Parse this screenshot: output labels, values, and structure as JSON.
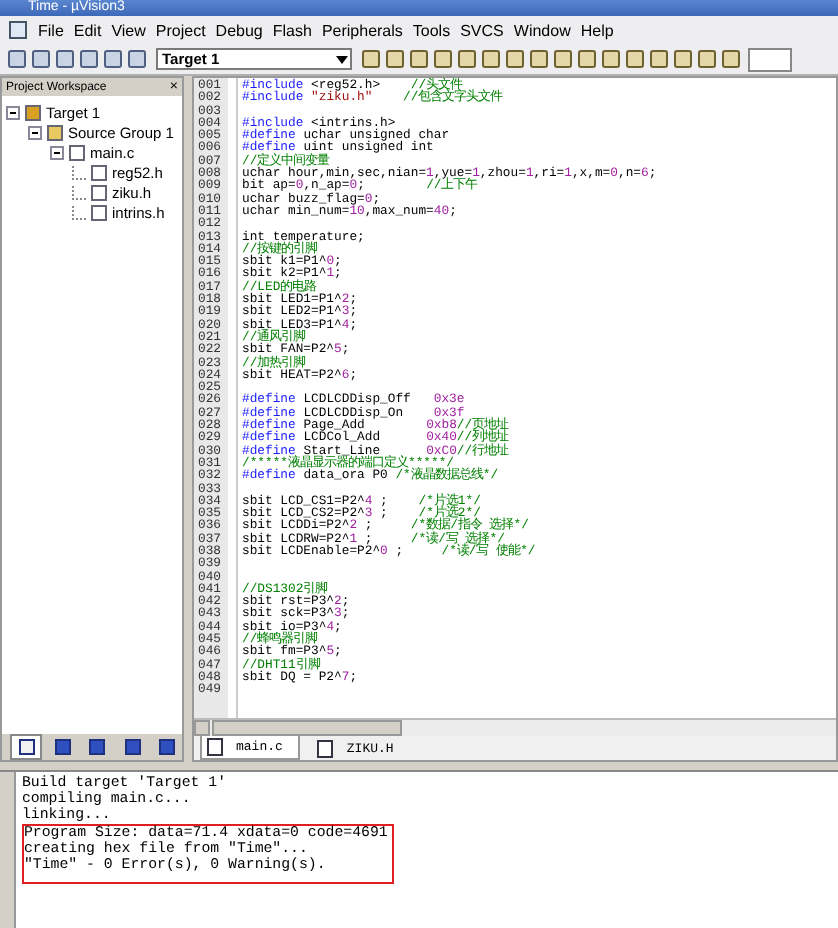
{
  "window": {
    "title": "Time - µVision3"
  },
  "menu": [
    "File",
    "Edit",
    "View",
    "Project",
    "Debug",
    "Flash",
    "Peripherals",
    "Tools",
    "SVCS",
    "Window",
    "Help"
  ],
  "toolbar": {
    "target": "Target 1"
  },
  "workspace": {
    "title": "Project Workspace",
    "close": "×",
    "tree": [
      {
        "label": "Target 1",
        "kind": "target",
        "expanded": true,
        "children": [
          {
            "label": "Source Group 1",
            "kind": "group",
            "expanded": true,
            "children": [
              {
                "label": "main.c",
                "kind": "source",
                "expanded": true,
                "children": [
                  {
                    "label": "reg52.h",
                    "kind": "header"
                  },
                  {
                    "label": "ziku.h",
                    "kind": "header"
                  },
                  {
                    "label": "intrins.h",
                    "kind": "header"
                  }
                ]
              }
            ]
          }
        ]
      }
    ],
    "tabs": [
      {
        "selected": true
      },
      {
        "selected": false
      },
      {
        "selected": false
      },
      {
        "selected": false
      },
      {
        "selected": false
      }
    ]
  },
  "editor": {
    "lines": [
      {
        "num": "001",
        "s": [
          {
            "text": "#include",
            "kind": "kw"
          },
          {
            "text": " <reg52.h>    ",
            "kind": "plain"
          },
          {
            "text": "//头文件",
            "kind": "comment"
          }
        ]
      },
      {
        "num": "002",
        "s": [
          {
            "text": "#include",
            "kind": "kw"
          },
          {
            "text": " \"ziku.h\"    ",
            "kind": "str"
          },
          {
            "text": "//包含文字头文件",
            "kind": "comment"
          }
        ]
      },
      {
        "num": "003"
      },
      {
        "num": "004",
        "s": [
          {
            "text": "#include",
            "kind": "kw"
          },
          {
            "text": " <intrins.h>",
            "kind": "plain"
          }
        ]
      },
      {
        "num": "005",
        "s": [
          {
            "text": "#define",
            "kind": "kw"
          },
          {
            "text": " uchar unsigned char",
            "kind": "plain"
          }
        ]
      },
      {
        "num": "006",
        "s": [
          {
            "text": "#define",
            "kind": "kw"
          },
          {
            "text": " uint unsigned int",
            "kind": "plain"
          }
        ]
      },
      {
        "num": "007",
        "s": [
          {
            "text": "//定义中间变量",
            "kind": "comment"
          }
        ]
      },
      {
        "num": "008",
        "s": [
          {
            "text": "uchar hour,min,sec,nian=",
            "kind": "plain"
          },
          {
            "text": "1",
            "kind": "num"
          },
          {
            "text": ",yue=",
            "kind": "plain"
          },
          {
            "text": "1",
            "kind": "num"
          },
          {
            "text": ",zhou=",
            "kind": "plain"
          },
          {
            "text": "1",
            "kind": "num"
          },
          {
            "text": ",ri=",
            "kind": "plain"
          },
          {
            "text": "1",
            "kind": "num"
          },
          {
            "text": ",x,m=",
            "kind": "plain"
          },
          {
            "text": "0",
            "kind": "num"
          },
          {
            "text": ",n=",
            "kind": "plain"
          },
          {
            "text": "6",
            "kind": "num"
          },
          {
            "text": ";",
            "kind": "plain"
          }
        ]
      },
      {
        "num": "009",
        "s": [
          {
            "text": "bit ap=",
            "kind": "plain"
          },
          {
            "text": "0",
            "kind": "num"
          },
          {
            "text": ",n_ap=",
            "kind": "plain"
          },
          {
            "text": "0",
            "kind": "num"
          },
          {
            "text": ";        ",
            "kind": "plain"
          },
          {
            "text": "//上下午",
            "kind": "comment"
          }
        ]
      },
      {
        "num": "010",
        "s": [
          {
            "text": "uchar buzz_flag=",
            "kind": "plain"
          },
          {
            "text": "0",
            "kind": "num"
          },
          {
            "text": ";",
            "kind": "plain"
          }
        ]
      },
      {
        "num": "011",
        "s": [
          {
            "text": "uchar min_num=",
            "kind": "plain"
          },
          {
            "text": "10",
            "kind": "num"
          },
          {
            "text": ",max_num=",
            "kind": "plain"
          },
          {
            "text": "40",
            "kind": "num"
          },
          {
            "text": ";",
            "kind": "plain"
          }
        ]
      },
      {
        "num": "012"
      },
      {
        "num": "013",
        "s": [
          {
            "text": "int temperature;",
            "kind": "plain"
          }
        ]
      },
      {
        "num": "014",
        "s": [
          {
            "text": "//按键的引脚",
            "kind": "comment"
          }
        ]
      },
      {
        "num": "015",
        "s": [
          {
            "text": "sbit k1=P1^",
            "kind": "plain"
          },
          {
            "text": "0",
            "kind": "num"
          },
          {
            "text": ";",
            "kind": "plain"
          }
        ]
      },
      {
        "num": "016",
        "s": [
          {
            "text": "sbit k2=P1^",
            "kind": "plain"
          },
          {
            "text": "1",
            "kind": "num"
          },
          {
            "text": ";",
            "kind": "plain"
          }
        ]
      },
      {
        "num": "017",
        "s": [
          {
            "text": "//LED的电路",
            "kind": "comment"
          }
        ]
      },
      {
        "num": "018",
        "s": [
          {
            "text": "sbit LED1=P1^",
            "kind": "plain"
          },
          {
            "text": "2",
            "kind": "num"
          },
          {
            "text": ";",
            "kind": "plain"
          }
        ]
      },
      {
        "num": "019",
        "s": [
          {
            "text": "sbit LED2=P1^",
            "kind": "plain"
          },
          {
            "text": "3",
            "kind": "num"
          },
          {
            "text": ";",
            "kind": "plain"
          }
        ]
      },
      {
        "num": "020",
        "s": [
          {
            "text": "sbit LED3=P1^",
            "kind": "plain"
          },
          {
            "text": "4",
            "kind": "num"
          },
          {
            "text": ";",
            "kind": "plain"
          }
        ]
      },
      {
        "num": "021",
        "s": [
          {
            "text": "//通风引脚",
            "kind": "comment"
          }
        ]
      },
      {
        "num": "022",
        "s": [
          {
            "text": "sbit FAN=P2^",
            "kind": "plain"
          },
          {
            "text": "5",
            "kind": "num"
          },
          {
            "text": ";",
            "kind": "plain"
          }
        ]
      },
      {
        "num": "023",
        "s": [
          {
            "text": "//加热引脚",
            "kind": "comment"
          }
        ]
      },
      {
        "num": "024",
        "s": [
          {
            "text": "sbit HEAT=P2^",
            "kind": "plain"
          },
          {
            "text": "6",
            "kind": "num"
          },
          {
            "text": ";",
            "kind": "plain"
          }
        ]
      },
      {
        "num": "025"
      },
      {
        "num": "026",
        "s": [
          {
            "text": "#define",
            "kind": "kw"
          },
          {
            "text": " LCDLCDDisp_Off   ",
            "kind": "plain"
          },
          {
            "text": "0x3e",
            "kind": "num"
          }
        ]
      },
      {
        "num": "027",
        "s": [
          {
            "text": "#define",
            "kind": "kw"
          },
          {
            "text": " LCDLCDDisp_On    ",
            "kind": "plain"
          },
          {
            "text": "0x3f",
            "kind": "num"
          }
        ]
      },
      {
        "num": "028",
        "s": [
          {
            "text": "#define",
            "kind": "kw"
          },
          {
            "text": " Page_Add        ",
            "kind": "plain"
          },
          {
            "text": "0xb8",
            "kind": "num"
          },
          {
            "text": "//页地址",
            "kind": "comment"
          }
        ]
      },
      {
        "num": "029",
        "s": [
          {
            "text": "#define",
            "kind": "kw"
          },
          {
            "text": " LCDCol_Add      ",
            "kind": "plain"
          },
          {
            "text": "0x40",
            "kind": "num"
          },
          {
            "text": "//列地址",
            "kind": "comment"
          }
        ]
      },
      {
        "num": "030",
        "s": [
          {
            "text": "#define",
            "kind": "kw"
          },
          {
            "text": " Start_Line      ",
            "kind": "plain"
          },
          {
            "text": "0xC0",
            "kind": "num"
          },
          {
            "text": "//行地址",
            "kind": "comment"
          }
        ]
      },
      {
        "num": "031",
        "s": [
          {
            "text": "/*****液晶显示器的端口定义*****/",
            "kind": "comment"
          }
        ]
      },
      {
        "num": "032",
        "s": [
          {
            "text": "#define",
            "kind": "kw"
          },
          {
            "text": " data_ora P0 ",
            "kind": "plain"
          },
          {
            "text": "/*液晶数据总线*/",
            "kind": "comment"
          }
        ]
      },
      {
        "num": "033"
      },
      {
        "num": "034",
        "s": [
          {
            "text": "sbit LCD_CS1=P2^",
            "kind": "plain"
          },
          {
            "text": "4",
            "kind": "num"
          },
          {
            "text": " ;    ",
            "kind": "plain"
          },
          {
            "text": "/*片选1*/",
            "kind": "comment"
          }
        ]
      },
      {
        "num": "035",
        "s": [
          {
            "text": "sbit LCD_CS2=P2^",
            "kind": "plain"
          },
          {
            "text": "3",
            "kind": "num"
          },
          {
            "text": " ;    ",
            "kind": "plain"
          },
          {
            "text": "/*片选2*/",
            "kind": "comment"
          }
        ]
      },
      {
        "num": "036",
        "s": [
          {
            "text": "sbit LCDDi=P2^",
            "kind": "plain"
          },
          {
            "text": "2",
            "kind": "num"
          },
          {
            "text": " ;     ",
            "kind": "plain"
          },
          {
            "text": "/*数据/指令 选择*/",
            "kind": "comment"
          }
        ]
      },
      {
        "num": "037",
        "s": [
          {
            "text": "sbit LCDRW=P2^",
            "kind": "plain"
          },
          {
            "text": "1",
            "kind": "num"
          },
          {
            "text": " ;     ",
            "kind": "plain"
          },
          {
            "text": "/*读/写 选择*/",
            "kind": "comment"
          }
        ]
      },
      {
        "num": "038",
        "s": [
          {
            "text": "sbit LCDEnable=P2^",
            "kind": "plain"
          },
          {
            "text": "0",
            "kind": "num"
          },
          {
            "text": " ;     ",
            "kind": "plain"
          },
          {
            "text": "/*读/写 使能*/",
            "kind": "comment"
          }
        ]
      },
      {
        "num": "039"
      },
      {
        "num": "040"
      },
      {
        "num": "041",
        "s": [
          {
            "text": "//DS1302引脚",
            "kind": "comment"
          }
        ]
      },
      {
        "num": "042",
        "s": [
          {
            "text": "sbit rst=P3^",
            "kind": "plain"
          },
          {
            "text": "2",
            "kind": "num"
          },
          {
            "text": ";",
            "kind": "plain"
          }
        ]
      },
      {
        "num": "043",
        "s": [
          {
            "text": "sbit sck=P3^",
            "kind": "plain"
          },
          {
            "text": "3",
            "kind": "num"
          },
          {
            "text": ";",
            "kind": "plain"
          }
        ]
      },
      {
        "num": "044",
        "s": [
          {
            "text": "sbit io=P3^",
            "kind": "plain"
          },
          {
            "text": "4",
            "kind": "num"
          },
          {
            "text": ";",
            "kind": "plain"
          }
        ]
      },
      {
        "num": "045",
        "s": [
          {
            "text": "//蜂鸣器引脚",
            "kind": "comment"
          }
        ]
      },
      {
        "num": "046",
        "s": [
          {
            "text": "sbit fm=P3^",
            "kind": "plain"
          },
          {
            "text": "5",
            "kind": "num"
          },
          {
            "text": ";",
            "kind": "plain"
          }
        ]
      },
      {
        "num": "047",
        "s": [
          {
            "text": "//DHT11引脚",
            "kind": "comment"
          }
        ]
      },
      {
        "num": "048",
        "s": [
          {
            "text": "sbit DQ = P2^",
            "kind": "plain"
          },
          {
            "text": "7",
            "kind": "num"
          },
          {
            "text": ";",
            "kind": "plain"
          }
        ]
      },
      {
        "num": "049"
      }
    ],
    "tabs": [
      {
        "label": "main.c",
        "selected": true
      },
      {
        "label": "ZIKU.H",
        "selected": false
      }
    ]
  },
  "output": {
    "lines": [
      "Build target 'Target 1'",
      "compiling main.c...",
      "linking..."
    ],
    "boxed_lines": [
      "Program Size: data=71.4 xdata=0 code=4691",
      "creating hex file from \"Time\"...",
      "\"Time\" - 0 Error(s), 0 Warning(s)."
    ]
  }
}
